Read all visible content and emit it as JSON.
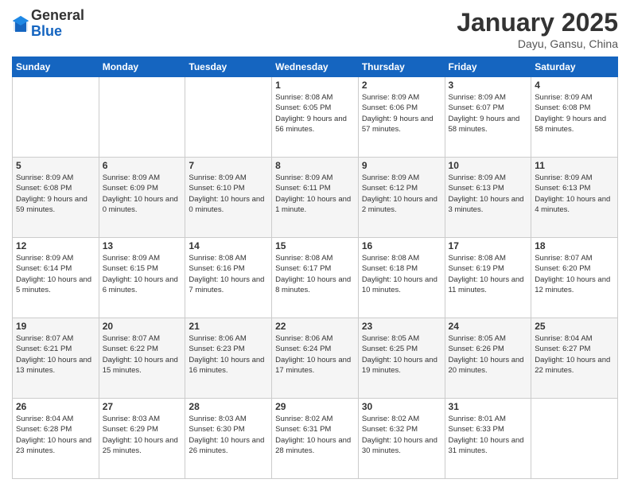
{
  "logo": {
    "general": "General",
    "blue": "Blue"
  },
  "header": {
    "title": "January 2025",
    "subtitle": "Dayu, Gansu, China"
  },
  "days_of_week": [
    "Sunday",
    "Monday",
    "Tuesday",
    "Wednesday",
    "Thursday",
    "Friday",
    "Saturday"
  ],
  "weeks": [
    [
      {
        "day": "",
        "info": ""
      },
      {
        "day": "",
        "info": ""
      },
      {
        "day": "",
        "info": ""
      },
      {
        "day": "1",
        "info": "Sunrise: 8:08 AM\nSunset: 6:05 PM\nDaylight: 9 hours\nand 56 minutes."
      },
      {
        "day": "2",
        "info": "Sunrise: 8:09 AM\nSunset: 6:06 PM\nDaylight: 9 hours\nand 57 minutes."
      },
      {
        "day": "3",
        "info": "Sunrise: 8:09 AM\nSunset: 6:07 PM\nDaylight: 9 hours\nand 58 minutes."
      },
      {
        "day": "4",
        "info": "Sunrise: 8:09 AM\nSunset: 6:08 PM\nDaylight: 9 hours\nand 58 minutes."
      }
    ],
    [
      {
        "day": "5",
        "info": "Sunrise: 8:09 AM\nSunset: 6:08 PM\nDaylight: 9 hours\nand 59 minutes."
      },
      {
        "day": "6",
        "info": "Sunrise: 8:09 AM\nSunset: 6:09 PM\nDaylight: 10 hours\nand 0 minutes."
      },
      {
        "day": "7",
        "info": "Sunrise: 8:09 AM\nSunset: 6:10 PM\nDaylight: 10 hours\nand 0 minutes."
      },
      {
        "day": "8",
        "info": "Sunrise: 8:09 AM\nSunset: 6:11 PM\nDaylight: 10 hours\nand 1 minute."
      },
      {
        "day": "9",
        "info": "Sunrise: 8:09 AM\nSunset: 6:12 PM\nDaylight: 10 hours\nand 2 minutes."
      },
      {
        "day": "10",
        "info": "Sunrise: 8:09 AM\nSunset: 6:13 PM\nDaylight: 10 hours\nand 3 minutes."
      },
      {
        "day": "11",
        "info": "Sunrise: 8:09 AM\nSunset: 6:13 PM\nDaylight: 10 hours\nand 4 minutes."
      }
    ],
    [
      {
        "day": "12",
        "info": "Sunrise: 8:09 AM\nSunset: 6:14 PM\nDaylight: 10 hours\nand 5 minutes."
      },
      {
        "day": "13",
        "info": "Sunrise: 8:09 AM\nSunset: 6:15 PM\nDaylight: 10 hours\nand 6 minutes."
      },
      {
        "day": "14",
        "info": "Sunrise: 8:08 AM\nSunset: 6:16 PM\nDaylight: 10 hours\nand 7 minutes."
      },
      {
        "day": "15",
        "info": "Sunrise: 8:08 AM\nSunset: 6:17 PM\nDaylight: 10 hours\nand 8 minutes."
      },
      {
        "day": "16",
        "info": "Sunrise: 8:08 AM\nSunset: 6:18 PM\nDaylight: 10 hours\nand 10 minutes."
      },
      {
        "day": "17",
        "info": "Sunrise: 8:08 AM\nSunset: 6:19 PM\nDaylight: 10 hours\nand 11 minutes."
      },
      {
        "day": "18",
        "info": "Sunrise: 8:07 AM\nSunset: 6:20 PM\nDaylight: 10 hours\nand 12 minutes."
      }
    ],
    [
      {
        "day": "19",
        "info": "Sunrise: 8:07 AM\nSunset: 6:21 PM\nDaylight: 10 hours\nand 13 minutes."
      },
      {
        "day": "20",
        "info": "Sunrise: 8:07 AM\nSunset: 6:22 PM\nDaylight: 10 hours\nand 15 minutes."
      },
      {
        "day": "21",
        "info": "Sunrise: 8:06 AM\nSunset: 6:23 PM\nDaylight: 10 hours\nand 16 minutes."
      },
      {
        "day": "22",
        "info": "Sunrise: 8:06 AM\nSunset: 6:24 PM\nDaylight: 10 hours\nand 17 minutes."
      },
      {
        "day": "23",
        "info": "Sunrise: 8:05 AM\nSunset: 6:25 PM\nDaylight: 10 hours\nand 19 minutes."
      },
      {
        "day": "24",
        "info": "Sunrise: 8:05 AM\nSunset: 6:26 PM\nDaylight: 10 hours\nand 20 minutes."
      },
      {
        "day": "25",
        "info": "Sunrise: 8:04 AM\nSunset: 6:27 PM\nDaylight: 10 hours\nand 22 minutes."
      }
    ],
    [
      {
        "day": "26",
        "info": "Sunrise: 8:04 AM\nSunset: 6:28 PM\nDaylight: 10 hours\nand 23 minutes."
      },
      {
        "day": "27",
        "info": "Sunrise: 8:03 AM\nSunset: 6:29 PM\nDaylight: 10 hours\nand 25 minutes."
      },
      {
        "day": "28",
        "info": "Sunrise: 8:03 AM\nSunset: 6:30 PM\nDaylight: 10 hours\nand 26 minutes."
      },
      {
        "day": "29",
        "info": "Sunrise: 8:02 AM\nSunset: 6:31 PM\nDaylight: 10 hours\nand 28 minutes."
      },
      {
        "day": "30",
        "info": "Sunrise: 8:02 AM\nSunset: 6:32 PM\nDaylight: 10 hours\nand 30 minutes."
      },
      {
        "day": "31",
        "info": "Sunrise: 8:01 AM\nSunset: 6:33 PM\nDaylight: 10 hours\nand 31 minutes."
      },
      {
        "day": "",
        "info": ""
      }
    ]
  ]
}
